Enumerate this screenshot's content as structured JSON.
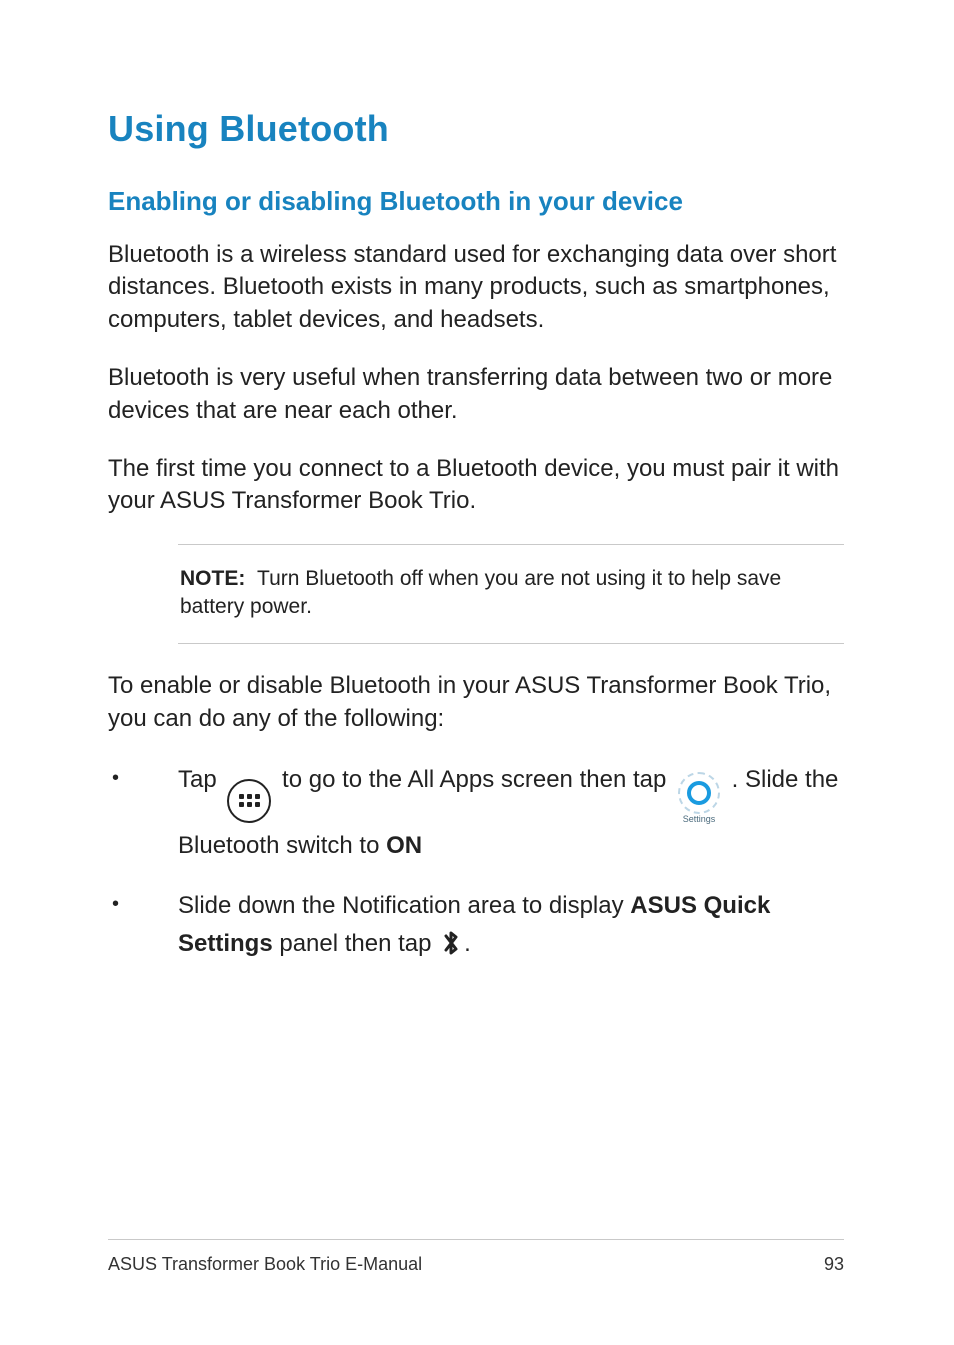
{
  "heading": "Using Bluetooth",
  "subheading": "Enabling or disabling Bluetooth in your device",
  "para1": "Bluetooth is a wireless standard used for exchanging data over short distances. Bluetooth exists in many products, such as smartphones, computers, tablet devices, and headsets.",
  "para2": "Bluetooth is very useful when transferring data between two or more devices that are near each other.",
  "para3": "The first time you connect to a Bluetooth device, you must pair it with your ASUS Transformer Book Trio.",
  "note": {
    "label": "NOTE:",
    "text": "Turn Bluetooth off when you are not using it to help save battery power."
  },
  "para4": "To enable or disable Bluetooth in your ASUS Transformer Book Trio, you can do any of the following:",
  "list": {
    "item1": {
      "pre": "Tap ",
      "mid": " to go to the All Apps screen then tap ",
      "post": ". Slide the Bluetooth switch to ",
      "on": "ON"
    },
    "item2": {
      "pre": "Slide down the Notification area to display ",
      "bold": "ASUS Quick Settings",
      "mid": " panel then tap ",
      "post": "."
    }
  },
  "icons": {
    "allapps": "all-apps-icon",
    "settings_label": "Settings",
    "bluetooth": "bluetooth-icon"
  },
  "footer": {
    "title": "ASUS Transformer Book Trio E-Manual",
    "page": "93"
  }
}
